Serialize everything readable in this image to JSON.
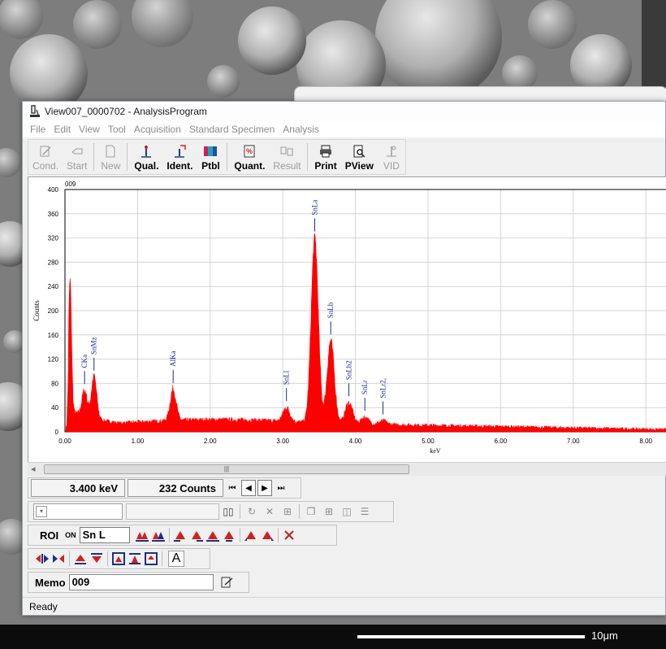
{
  "window": {
    "title": "View007_0000702 - AnalysisProgram"
  },
  "menu": [
    "File",
    "Edit",
    "View",
    "Tool",
    "Acquisition",
    "Standard Specimen",
    "Analysis"
  ],
  "toolbar": {
    "cond": "Cond.",
    "start": "Start",
    "new": "New",
    "qual": "Qual.",
    "ident": "Ident.",
    "ptbl": "Ptbl",
    "quant": "Quant.",
    "result": "Result",
    "print": "Print",
    "pview": "PView",
    "vid": "VID"
  },
  "chart_data": {
    "type": "line",
    "label_top": "009",
    "xlabel": "keV",
    "ylabel": "Counts",
    "xlim": [
      0,
      8.3
    ],
    "ylim": [
      0,
      400
    ],
    "xticks": [
      "0.00",
      "1.00",
      "2.00",
      "3.00",
      "4.00",
      "5.00",
      "6.00",
      "7.00",
      "8.00"
    ],
    "yticks": [
      "0",
      "40",
      "80",
      "120",
      "160",
      "200",
      "240",
      "280",
      "320",
      "360",
      "400"
    ],
    "color": "#ff0000",
    "peaks": [
      {
        "x": 0.07,
        "y": 250
      },
      {
        "x": 0.27,
        "y": 68
      },
      {
        "x": 0.4,
        "y": 90
      },
      {
        "x": 1.49,
        "y": 70
      },
      {
        "x": 3.05,
        "y": 40
      },
      {
        "x": 3.44,
        "y": 320
      },
      {
        "x": 3.66,
        "y": 150
      },
      {
        "x": 3.91,
        "y": 48
      },
      {
        "x": 4.13,
        "y": 24
      },
      {
        "x": 4.38,
        "y": 18
      }
    ],
    "annotations": [
      {
        "label": "CKa",
        "x": 0.27,
        "y": 68
      },
      {
        "label": "SnMz",
        "x": 0.4,
        "y": 90
      },
      {
        "label": "AlKa",
        "x": 1.49,
        "y": 70
      },
      {
        "label": "SnLl",
        "x": 3.05,
        "y": 40
      },
      {
        "label": "SnLa",
        "x": 3.44,
        "y": 320
      },
      {
        "label": "SnLb",
        "x": 3.66,
        "y": 150
      },
      {
        "label": "SnLb2",
        "x": 3.91,
        "y": 48
      },
      {
        "label": "SnLr",
        "x": 4.13,
        "y": 24
      },
      {
        "label": "SnLr2,",
        "x": 4.38,
        "y": 18
      }
    ]
  },
  "readout": {
    "energy": "3.400 keV",
    "counts": "232 Counts"
  },
  "roi": {
    "label": "ROI",
    "on": "ON",
    "value": "Sn L"
  },
  "memo": {
    "label": "Memo",
    "value": "009"
  },
  "status": "Ready",
  "scale_label": "10μm"
}
